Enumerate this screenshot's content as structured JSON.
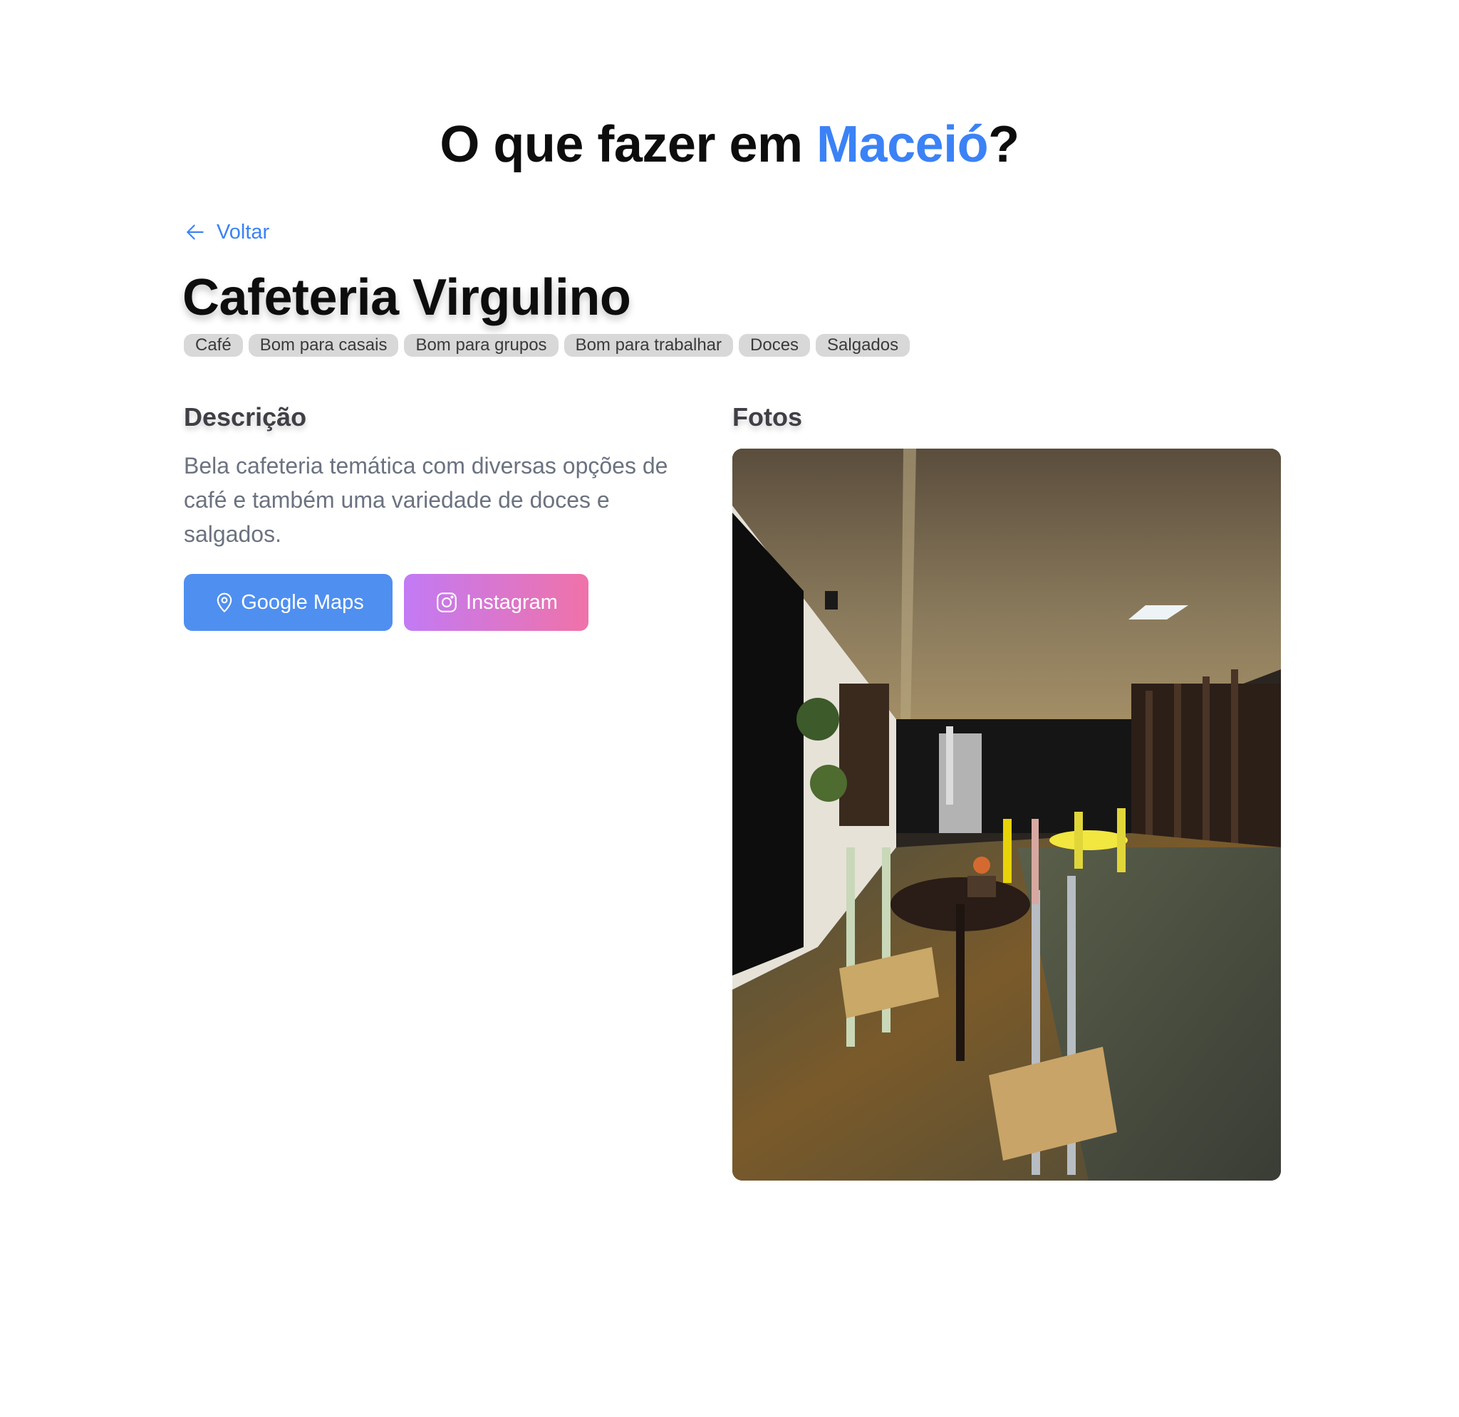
{
  "header": {
    "title_prefix": "O que fazer em ",
    "title_city": "Maceió",
    "title_suffix": "?",
    "accent_color": "#3b82f6"
  },
  "nav": {
    "back_label": "Voltar",
    "back_icon": "arrow-left-icon"
  },
  "place": {
    "name": "Cafeteria Virgulino",
    "tags": [
      "Café",
      "Bom para casais",
      "Bom para grupos",
      "Bom para trabalhar",
      "Doces",
      "Salgados"
    ]
  },
  "description": {
    "heading": "Descrição",
    "text": "Bela cafeteria temática com diversas opções de café e também uma variedade de doces e salgados."
  },
  "actions": {
    "maps_label": "Google Maps",
    "maps_icon": "map-pin-icon",
    "maps_color": "#4f8ff0",
    "instagram_label": "Instagram",
    "instagram_icon": "instagram-icon",
    "instagram_colors": [
      "#c27af5",
      "#f072a8"
    ]
  },
  "photos": {
    "heading": "Fotos"
  }
}
